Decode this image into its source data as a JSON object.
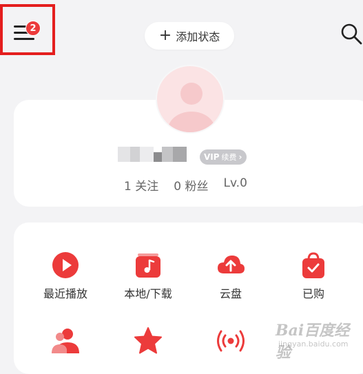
{
  "header": {
    "notification_count": "2",
    "add_status_label": "添加状态"
  },
  "profile": {
    "vip_label": "VIP",
    "vip_renew_label": "续费",
    "following": "1 关注",
    "followers": "0 粉丝",
    "level": "Lv.0"
  },
  "grid": {
    "items": [
      {
        "label": "最近播放",
        "icon": "play-icon"
      },
      {
        "label": "本地/下载",
        "icon": "music-note-icon"
      },
      {
        "label": "云盘",
        "icon": "cloud-upload-icon"
      },
      {
        "label": "已购",
        "icon": "shopping-bag-icon"
      },
      {
        "label": "",
        "icon": "users-icon"
      },
      {
        "label": "",
        "icon": "star-icon"
      },
      {
        "label": "",
        "icon": "broadcast-icon"
      }
    ]
  },
  "colors": {
    "accent": "#ec3b3b",
    "highlight_box": "#e41e1e",
    "background": "#f3f3f5"
  },
  "watermark": {
    "text": "Bai百度经验",
    "sub": "jingyan.baidu.com"
  }
}
